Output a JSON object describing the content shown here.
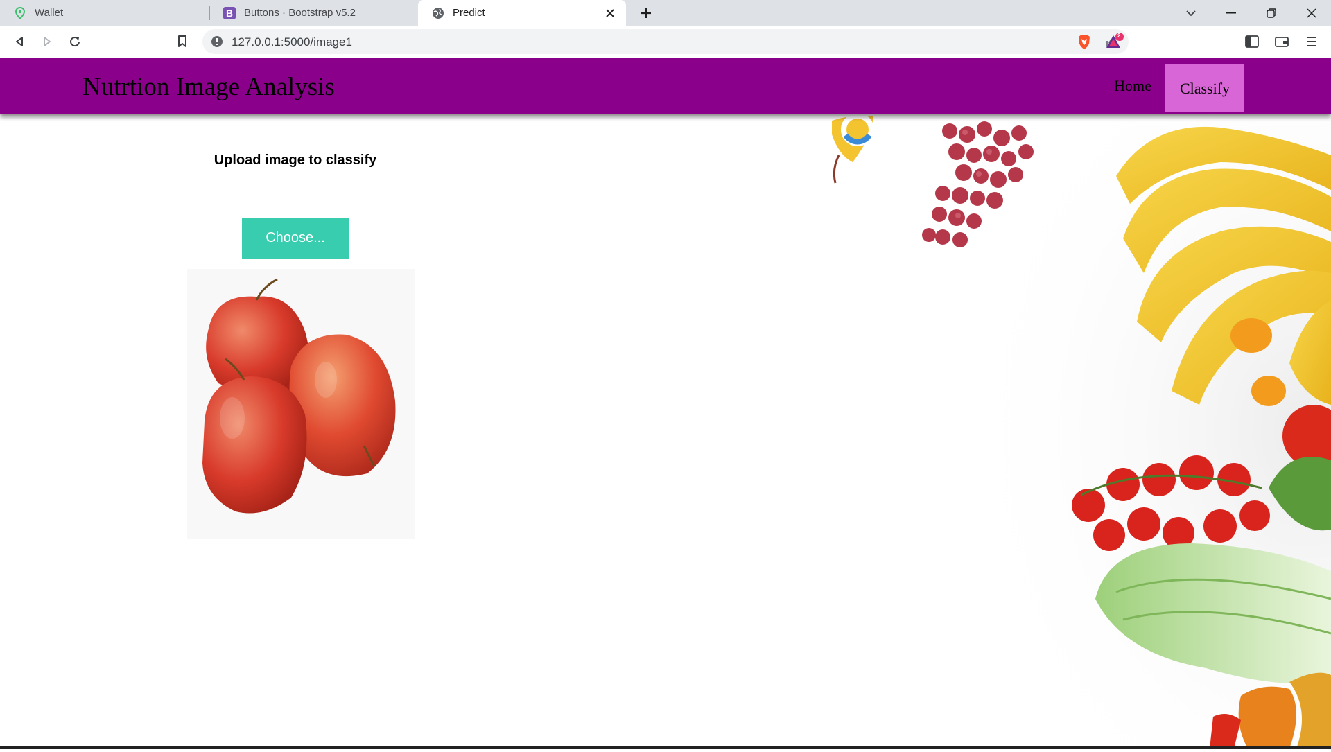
{
  "browser": {
    "tabs": [
      {
        "title": "Wallet",
        "active": false,
        "favicon": "wallet-icon"
      },
      {
        "title": "Buttons · Bootstrap v5.2",
        "active": false,
        "favicon": "bootstrap-icon",
        "favicon_letter": "B"
      },
      {
        "title": "Predict",
        "active": true,
        "favicon": "globe-icon"
      }
    ],
    "url": "127.0.0.1:5000/image1",
    "notification_badge": "2"
  },
  "navbar": {
    "brand": "Nutrtion Image Analysis",
    "links": [
      {
        "label": "Home",
        "active": false
      },
      {
        "label": "Classify",
        "active": true
      }
    ],
    "background": "#8b008b",
    "active_background": "#d966d6"
  },
  "main": {
    "upload_heading": "Upload image to classify",
    "choose_button": "Choose...",
    "button_color": "#39cdb0",
    "preview_image": "apples-image"
  }
}
